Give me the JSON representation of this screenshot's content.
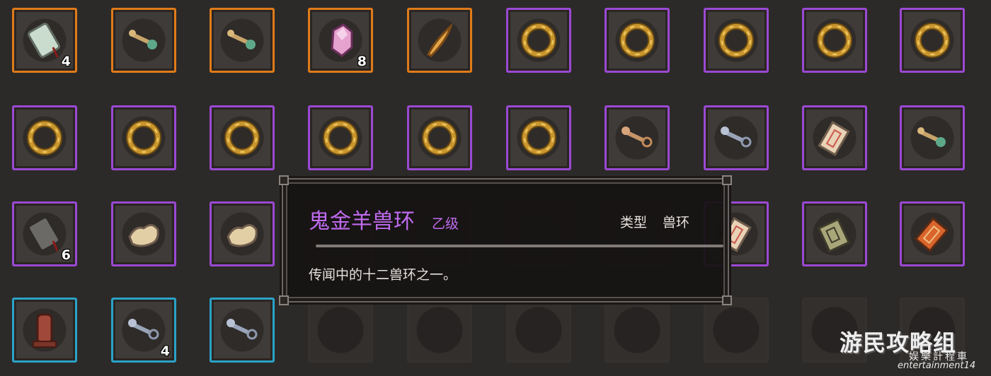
{
  "colors": {
    "rarity_orange": "#e07b1a",
    "rarity_purple": "#9b49d4",
    "rarity_blue": "#2aa3c9",
    "name_purple": "#c06bf0"
  },
  "inventory": {
    "rows": [
      [
        {
          "icon": "jade-tablet-icon",
          "rarity": "orange",
          "count": "4"
        },
        {
          "icon": "jade-key-icon",
          "rarity": "orange"
        },
        {
          "icon": "jade-key-icon",
          "rarity": "orange"
        },
        {
          "icon": "pink-crystal-icon",
          "rarity": "orange",
          "count": "8"
        },
        {
          "icon": "feather-icon",
          "rarity": "orange"
        },
        {
          "icon": "gold-ring-icon",
          "rarity": "purple"
        },
        {
          "icon": "gold-ring-icon",
          "rarity": "purple"
        },
        {
          "icon": "gold-ring-icon",
          "rarity": "purple"
        },
        {
          "icon": "gold-ring-icon",
          "rarity": "purple"
        },
        {
          "icon": "gold-ring-icon",
          "rarity": "purple"
        }
      ],
      [
        {
          "icon": "gold-ring-icon",
          "rarity": "purple"
        },
        {
          "icon": "gold-ring-icon",
          "rarity": "purple"
        },
        {
          "icon": "gold-ring-icon",
          "rarity": "purple"
        },
        {
          "icon": "gold-ring-icon",
          "rarity": "purple"
        },
        {
          "icon": "gold-ring-icon",
          "rarity": "purple"
        },
        {
          "icon": "gold-ring-icon",
          "rarity": "purple"
        },
        {
          "icon": "brass-key-icon",
          "rarity": "purple"
        },
        {
          "icon": "silver-key-icon",
          "rarity": "purple"
        },
        {
          "icon": "paper-talisman-icon",
          "rarity": "purple"
        },
        {
          "icon": "jade-key-icon",
          "rarity": "purple"
        }
      ],
      [
        {
          "icon": "stone-tablet-icon",
          "rarity": "purple",
          "count": "6"
        },
        {
          "icon": "map-scroll-icon",
          "rarity": "purple"
        },
        {
          "icon": "map-scroll-icon",
          "rarity": "purple"
        },
        {
          "icon": "hidden",
          "rarity": "none"
        },
        {
          "icon": "hidden",
          "rarity": "none"
        },
        {
          "icon": "hidden",
          "rarity": "none"
        },
        {
          "icon": "hidden",
          "rarity": "none"
        },
        {
          "icon": "paper-talisman-icon",
          "rarity": "purple"
        },
        {
          "icon": "book-icon",
          "rarity": "purple"
        },
        {
          "icon": "red-talisman-icon",
          "rarity": "purple"
        }
      ],
      [
        {
          "icon": "wooden-tablet-icon",
          "rarity": "blue"
        },
        {
          "icon": "silver-key-icon",
          "rarity": "blue",
          "count": "4"
        },
        {
          "icon": "silver-key-icon",
          "rarity": "blue"
        },
        {
          "icon": "",
          "rarity": "empty"
        },
        {
          "icon": "",
          "rarity": "empty"
        },
        {
          "icon": "",
          "rarity": "empty"
        },
        {
          "icon": "",
          "rarity": "empty"
        },
        {
          "icon": "",
          "rarity": "empty"
        },
        {
          "icon": "",
          "rarity": "empty"
        },
        {
          "icon": "",
          "rarity": "empty"
        }
      ]
    ]
  },
  "tooltip": {
    "name": "鬼金羊兽环",
    "grade": "乙级",
    "type_label": "类型",
    "type_value": "兽环",
    "description": "传闻中的十二兽环之一。"
  },
  "watermark": {
    "line1": "游民攻略组",
    "line2": "娱樂計程車",
    "line3": "entertainment14"
  }
}
